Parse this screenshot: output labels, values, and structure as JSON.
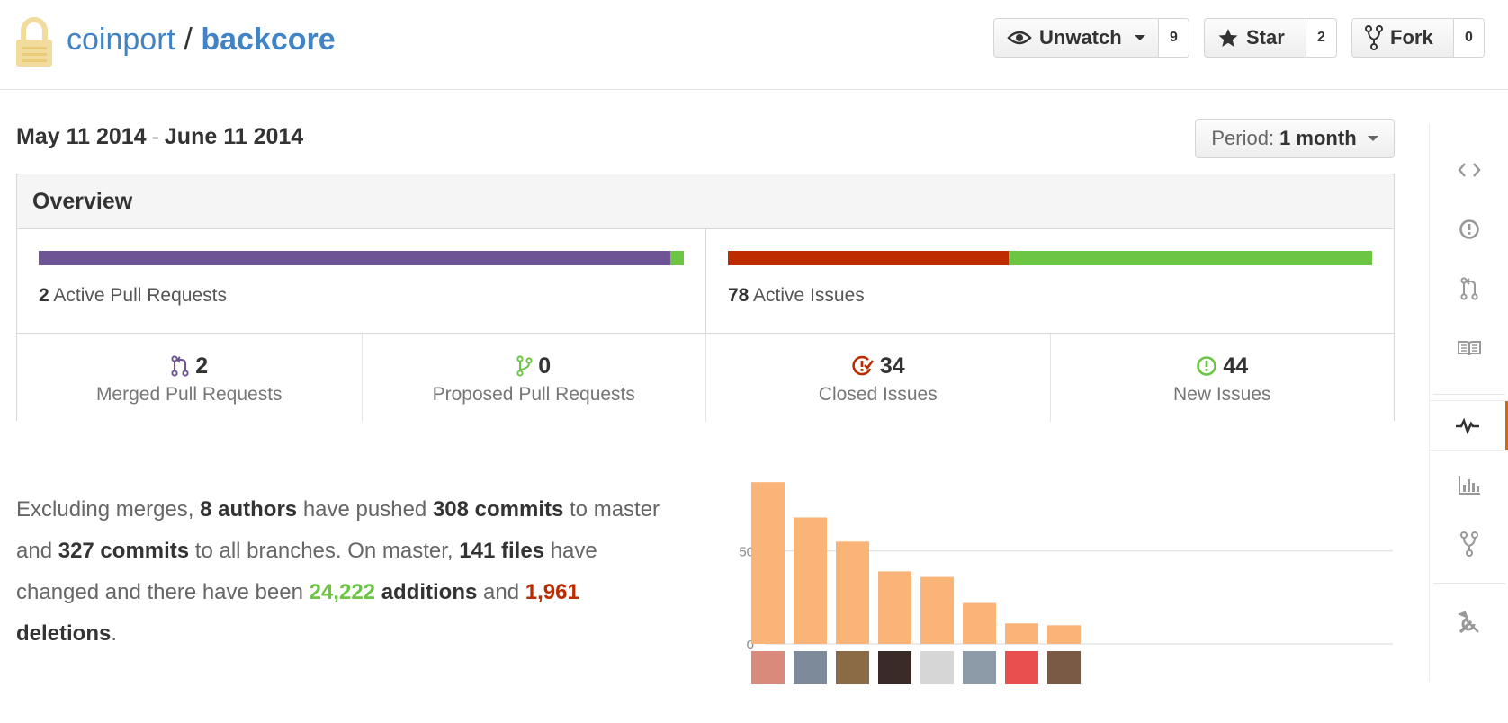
{
  "repo": {
    "owner": "coinport",
    "separator": "/",
    "name": "backcore",
    "lock_icon": "lock-icon"
  },
  "actions": {
    "unwatch": {
      "label": "Unwatch",
      "count": "9",
      "icon": "eye-icon"
    },
    "star": {
      "label": "Star",
      "count": "2",
      "icon": "star-icon"
    },
    "fork": {
      "label": "Fork",
      "count": "0",
      "icon": "fork-icon"
    }
  },
  "date_range": {
    "start": "May 11 2014",
    "dash": "-",
    "end": "June 11 2014"
  },
  "period": {
    "label": "Period:",
    "value": "1 month"
  },
  "overview": {
    "title": "Overview",
    "pull_requests": {
      "count": "2",
      "label": "Active Pull Requests",
      "bar": {
        "merged_fraction": 0.979,
        "merged_color": "#6e5494",
        "proposed_color": "#6cc644"
      }
    },
    "issues": {
      "count": "78",
      "label": "Active Issues",
      "bar": {
        "closed_fraction": 0.436,
        "closed_color": "#bd2c00",
        "new_color": "#6cc644"
      }
    },
    "stats": [
      {
        "count": "2",
        "label": "Merged Pull Requests",
        "icon": "merged-pr-icon",
        "color": "#6e5494"
      },
      {
        "count": "0",
        "label": "Proposed Pull Requests",
        "icon": "proposed-pr-icon",
        "color": "#6cc644"
      },
      {
        "count": "34",
        "label": "Closed Issues",
        "icon": "closed-issue-icon",
        "color": "#bd2c00"
      },
      {
        "count": "44",
        "label": "New Issues",
        "icon": "new-issue-icon",
        "color": "#6cc644"
      }
    ]
  },
  "commits_summary": {
    "p1": "Excluding merges,",
    "authors": "8 authors",
    "p2": "have pushed",
    "master_commits": "308 commits",
    "p3": "to master and",
    "all_commits": "327 commits",
    "p4": "to all branches. On master,",
    "files": "141 files",
    "p5": "have changed and there have been",
    "additions_num": "24,222",
    "additions_word": "additions",
    "p6": "and",
    "deletions_num": "1,961",
    "deletions_word": "deletions",
    "p7": "."
  },
  "chart_data": {
    "type": "bar",
    "categories": [
      "1",
      "2",
      "3",
      "4",
      "5",
      "6",
      "7",
      "8"
    ],
    "values": [
      87,
      68,
      55,
      39,
      36,
      22,
      11,
      10
    ],
    "ylim": [
      0,
      90
    ],
    "yticks": [
      "0",
      "50"
    ],
    "bar_color": "#fbb477",
    "grid": true
  },
  "sidenav": [
    {
      "icon": "code-icon"
    },
    {
      "icon": "issues-icon"
    },
    {
      "icon": "pull-requests-icon"
    },
    {
      "icon": "wiki-icon"
    },
    {
      "icon": "pulse-icon",
      "selected": true
    },
    {
      "icon": "graphs-icon"
    },
    {
      "icon": "network-icon"
    },
    {
      "icon": "settings-icon"
    }
  ]
}
